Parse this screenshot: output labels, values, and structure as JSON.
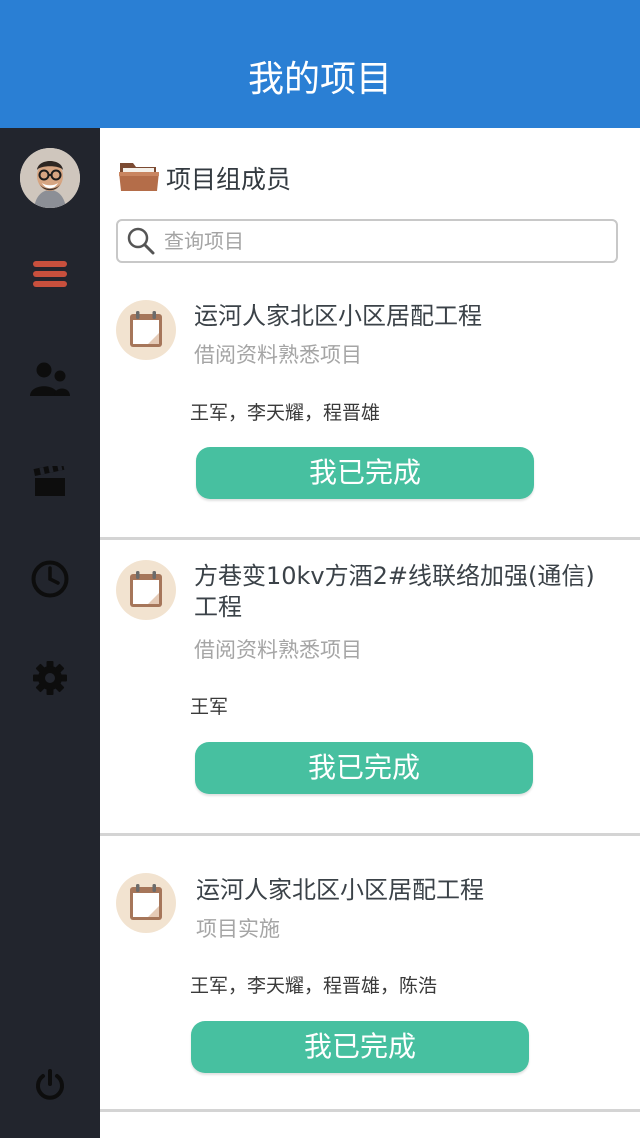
{
  "header": {
    "title": "我的项目"
  },
  "sidebar": {
    "items": [
      {
        "icon": "menu-icon",
        "color": "#c8503d"
      },
      {
        "icon": "users-icon",
        "color": "#111111"
      },
      {
        "icon": "clapperboard-icon",
        "color": "#111111"
      },
      {
        "icon": "clock-icon",
        "color": "#111111"
      },
      {
        "icon": "gear-icon",
        "color": "#111111"
      },
      {
        "icon": "power-icon",
        "color": "#111111"
      }
    ]
  },
  "section": {
    "title": "项目组成员",
    "icon": "folder-icon"
  },
  "search": {
    "placeholder": "查询项目",
    "value": ""
  },
  "projects": [
    {
      "title": "运河人家北区小区居配工程",
      "stage": "借阅资料熟悉项目",
      "members": "王军，李天耀，程晋雄",
      "action": "我已完成"
    },
    {
      "title": "方巷变10kv方酒2#线联络加强(通信)工程",
      "stage": "借阅资料熟悉项目",
      "members": "王军",
      "action": "我已完成"
    },
    {
      "title": "运河人家北区小区居配工程",
      "stage": "项目实施",
      "members": "王军，李天耀，程晋雄，陈浩",
      "action": "我已完成"
    }
  ],
  "colors": {
    "header": "#2a7fd4",
    "sidebar": "#22252d",
    "button": "#47c0a0",
    "accent": "#c8503d"
  }
}
